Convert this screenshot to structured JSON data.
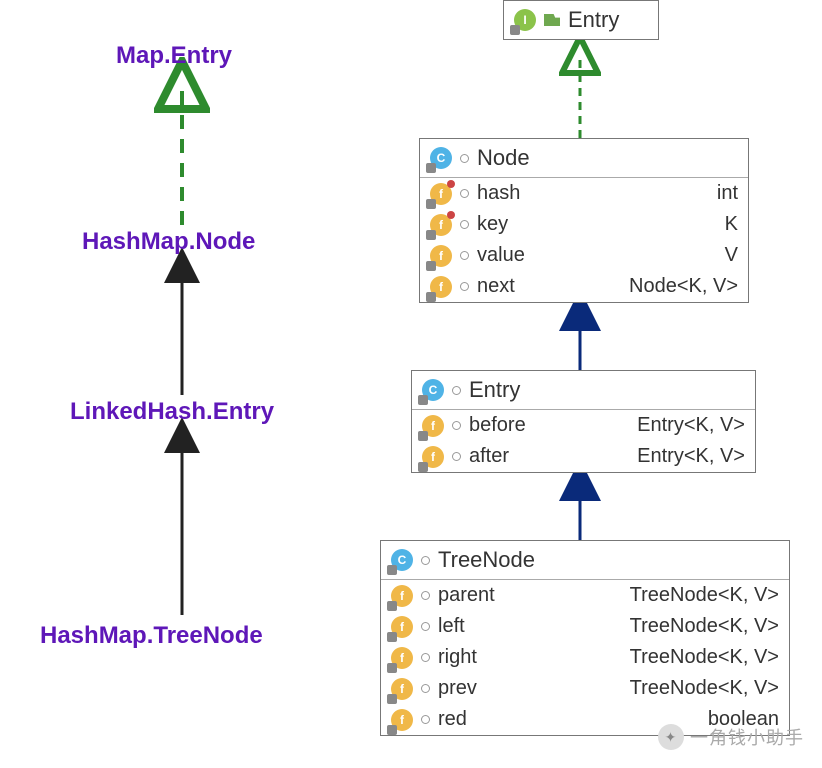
{
  "labels": {
    "map_entry": "Map.Entry",
    "hashmap_node": "HashMap.Node",
    "linkedhash_entry": "LinkedHash.Entry",
    "hashmap_treenode": "HashMap.TreeNode"
  },
  "interface_box": {
    "name": "Entry",
    "kind": "I"
  },
  "node_box": {
    "name": "Node",
    "kind": "C",
    "fields": [
      {
        "name": "hash",
        "type": "int"
      },
      {
        "name": "key",
        "type": "K"
      },
      {
        "name": "value",
        "type": "V"
      },
      {
        "name": "next",
        "type": "Node<K, V>"
      }
    ]
  },
  "entry_box": {
    "name": "Entry",
    "kind": "C",
    "fields": [
      {
        "name": "before",
        "type": "Entry<K, V>"
      },
      {
        "name": "after",
        "type": "Entry<K, V>"
      }
    ]
  },
  "treenode_box": {
    "name": "TreeNode",
    "kind": "C",
    "fields": [
      {
        "name": "parent",
        "type": "TreeNode<K, V>"
      },
      {
        "name": "left",
        "type": "TreeNode<K, V>"
      },
      {
        "name": "right",
        "type": "TreeNode<K, V>"
      },
      {
        "name": "prev",
        "type": "TreeNode<K, V>"
      },
      {
        "name": "red",
        "type": "boolean"
      }
    ]
  },
  "watermark": "一角钱小助手"
}
